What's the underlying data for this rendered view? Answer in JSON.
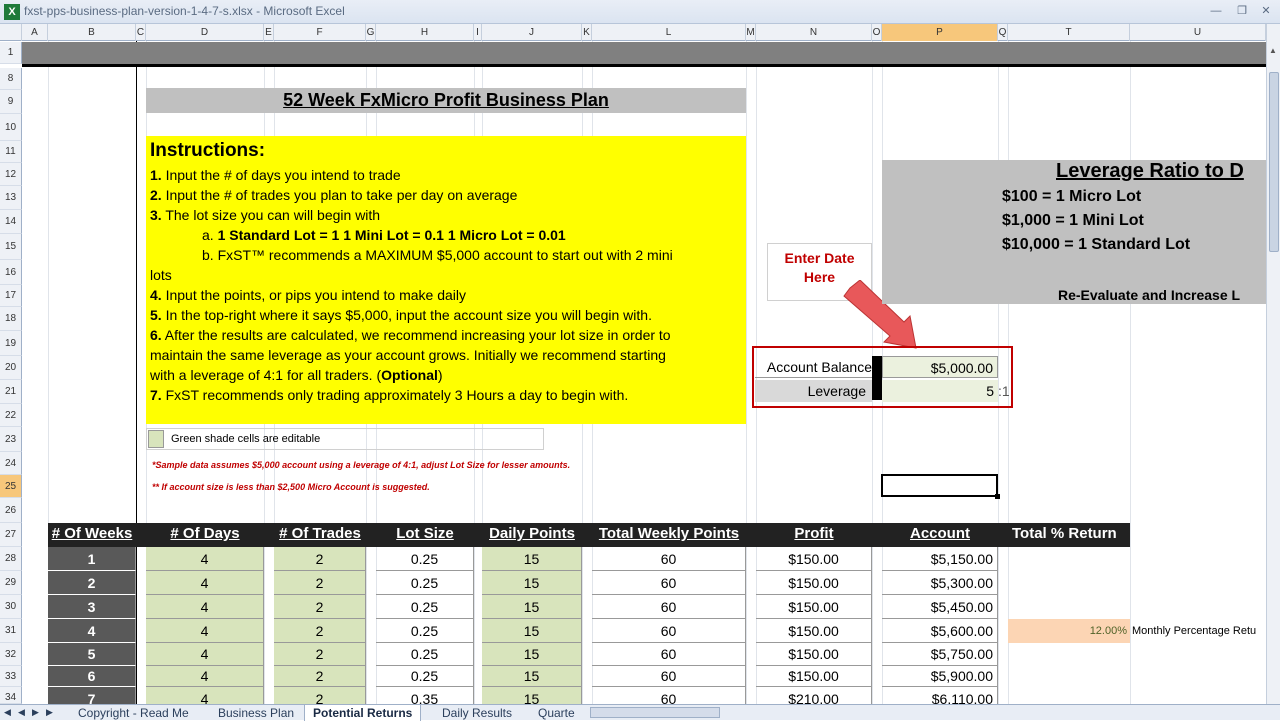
{
  "window": {
    "title": "fxst-pps-business-plan-version-1-4-7-s.xlsx - Microsoft Excel",
    "app_icon": "X"
  },
  "columns": [
    "A",
    "B",
    "C",
    "D",
    "E",
    "F",
    "G",
    "H",
    "I",
    "J",
    "K",
    "L",
    "M",
    "N",
    "O",
    "P",
    "Q",
    "T",
    "U"
  ],
  "rows": [
    "1",
    "8",
    "9",
    "10",
    "11",
    "12",
    "13",
    "14",
    "15",
    "16",
    "17",
    "18",
    "19",
    "20",
    "21",
    "22",
    "23",
    "24",
    "25",
    "26",
    "27",
    "28",
    "29",
    "30",
    "31",
    "32",
    "33",
    "34"
  ],
  "plan_title": "52 Week FxMicro Profit Business Plan",
  "instructions": {
    "heading": "Instructions:",
    "lines": [
      {
        "num": "1.",
        "text": " Input the # of days you intend to trade"
      },
      {
        "num": "2.",
        "text": " Input the # of trades you plan to take per day on average"
      },
      {
        "num": "3.",
        "text": " The lot size you can will begin with"
      },
      {
        "num": "",
        "text": "a. ",
        "bold": "1 Standard Lot = 1     1 Mini Lot = 0.1    1 Micro Lot = 0.01"
      },
      {
        "num": "",
        "text": "b.  FxST™ recommends a MAXIMUM  $5,000 account to start out with 2 mini"
      },
      {
        "num": "",
        "text": "lots"
      },
      {
        "num": "4.",
        "text": " Input the points, or pips you intend to make daily"
      },
      {
        "num": "5.",
        "text": " In the top-right where it says $5,000, input the account size you will begin with."
      },
      {
        "num": "6.",
        "text": " After the results are calculated, we recommend increasing your lot size in order to"
      },
      {
        "num": "",
        "text": "maintain the same leverage as your account grows. Initially we recommend starting"
      },
      {
        "num": "",
        "text": "with a leverage of 4:1 for all traders. (",
        "bold": "Optional",
        "tail": ")"
      },
      {
        "num": "7.",
        "text": " FxST recommends only trading approximately 3 Hours a day to begin with."
      }
    ]
  },
  "editable_note": "Green shade cells are editable",
  "notes": [
    "*Sample data assumes $5,000 account using a leverage of 4:1, adjust Lot Size for lesser amounts.",
    "** If account size is less than $2,500 Micro Account is suggested."
  ],
  "callout": {
    "line1": "Enter Date",
    "line2": "Here"
  },
  "account": {
    "balance_label": "Account Balance",
    "balance_value": "$5,000.00",
    "leverage_label": "Leverage",
    "leverage_value": "5",
    "leverage_suffix": ":1"
  },
  "leverage_box": {
    "title": "Leverage Ratio to D",
    "lines": [
      "$100 = 1 Micro Lot",
      "$1,000 = 1 Mini Lot",
      "$10,000 = 1 Standard Lot"
    ],
    "footer": "Re-Evaluate and Increase L"
  },
  "table": {
    "headers": [
      "# Of Weeks",
      "# Of Days",
      "# Of Trades",
      "Lot Size",
      "Daily Points",
      "Total Weekly Points",
      "Profit",
      "Account",
      "Total  % Return"
    ],
    "rows": [
      [
        "1",
        "4",
        "2",
        "0.25",
        "15",
        "60",
        "$150.00",
        "$5,150.00"
      ],
      [
        "2",
        "4",
        "2",
        "0.25",
        "15",
        "60",
        "$150.00",
        "$5,300.00"
      ],
      [
        "3",
        "4",
        "2",
        "0.25",
        "15",
        "60",
        "$150.00",
        "$5,450.00"
      ],
      [
        "4",
        "4",
        "2",
        "0.25",
        "15",
        "60",
        "$150.00",
        "$5,600.00"
      ],
      [
        "5",
        "4",
        "2",
        "0.25",
        "15",
        "60",
        "$150.00",
        "$5,750.00"
      ],
      [
        "6",
        "4",
        "2",
        "0.25",
        "15",
        "60",
        "$150.00",
        "$5,900.00"
      ],
      [
        "7",
        "4",
        "2",
        "0.35",
        "15",
        "60",
        "$210.00",
        "$6,110.00"
      ]
    ],
    "monthly_pct": "12.00%",
    "monthly_label": "Monthly Percentage Retu"
  },
  "tabs": [
    "Copyright - Read Me",
    "Business Plan",
    "Potential Returns",
    "Daily Results",
    "Quarte"
  ],
  "active_tab": "Potential Returns",
  "colors": {
    "yellow": "#ffff00",
    "green_cell": "#d8e4bc",
    "dark_header": "#222222",
    "accent_red": "#c00000",
    "selection": "#f7c77b"
  }
}
